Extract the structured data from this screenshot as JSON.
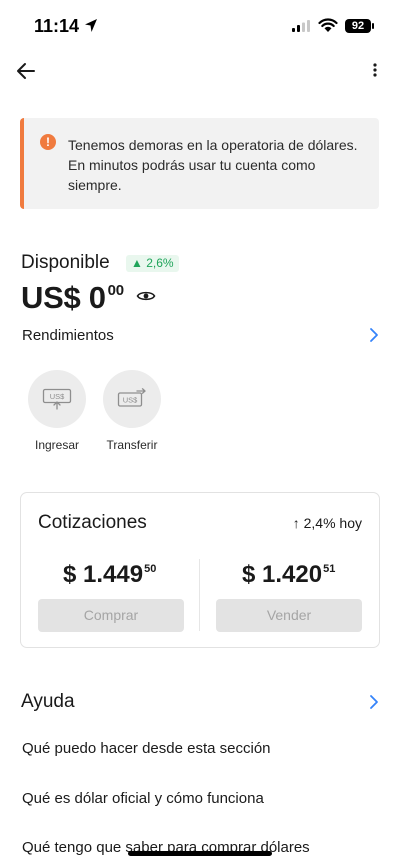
{
  "status_bar": {
    "time": "11:14",
    "battery": "92"
  },
  "alert": {
    "text": "Tenemos demoras en la operatoria de dólares. En minutos podrás usar tu cuenta como siempre.",
    "icon": "exclamation-icon",
    "accent_color": "#f07b3f"
  },
  "balance": {
    "label": "Disponible",
    "change_badge": "▲ 2,6%",
    "amount_main": "US$ 0",
    "amount_cents": "00",
    "rendimientos_label": "Rendimientos"
  },
  "actions": [
    {
      "label": "Ingresar",
      "icon": "deposit-usd-icon"
    },
    {
      "label": "Transferir",
      "icon": "transfer-usd-icon"
    }
  ],
  "quotes": {
    "title": "Cotizaciones",
    "change": "↑ 2,4% hoy",
    "buy": {
      "main": "$ 1.449",
      "cents": "50",
      "button_label": "Comprar"
    },
    "sell": {
      "main": "$ 1.420",
      "cents": "51",
      "button_label": "Vender"
    }
  },
  "help": {
    "title": "Ayuda",
    "items": [
      "Qué puedo hacer desde esta sección",
      "Qué es dólar oficial y cómo funciona",
      "Qué tengo que saber para comprar dólares"
    ]
  },
  "colors": {
    "link_blue": "#3483fa",
    "positive_green": "#1fa45a"
  }
}
